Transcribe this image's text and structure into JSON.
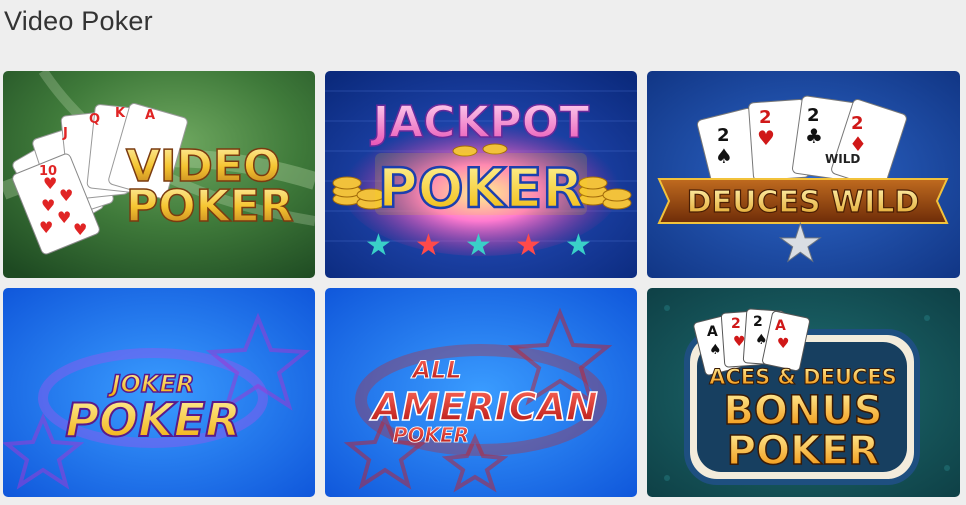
{
  "page": {
    "title": "Video Poker"
  },
  "games": [
    {
      "logo_line1": "VIDEO",
      "logo_line2": "POKER",
      "cards": [
        "10",
        "J",
        "Q",
        "K",
        "A"
      ]
    },
    {
      "logo_line1": "JACKPOT",
      "logo_line2": "POKER"
    },
    {
      "logo_line1": "DEUCES WILD",
      "cards": [
        "2",
        "2",
        "2",
        "2"
      ],
      "card_caption": "WILD"
    },
    {
      "logo_line1": "JOKER",
      "logo_line2": "POKER"
    },
    {
      "logo_line1": "ALL",
      "logo_line2": "AMERICAN",
      "logo_line3": "POKER"
    },
    {
      "logo_line1": "ACES & DEUCES",
      "logo_line2": "BONUS",
      "logo_line3": "POKER",
      "cards": [
        "A",
        "2",
        "2",
        "A"
      ]
    }
  ],
  "colors": {
    "page_background": "#eeeeee",
    "title_text": "#333333",
    "gold_text": "#f5c531",
    "jackpot_pink": "#e84fb3",
    "joker_purple": "#a23dd6",
    "american_red": "#d4201f",
    "bonus_teal": "#1f6f73"
  },
  "icons": [
    "heart-suit-icon",
    "spade-suit-icon",
    "diamond-suit-icon",
    "club-suit-icon",
    "star-icon",
    "gold-coins-icon"
  ]
}
